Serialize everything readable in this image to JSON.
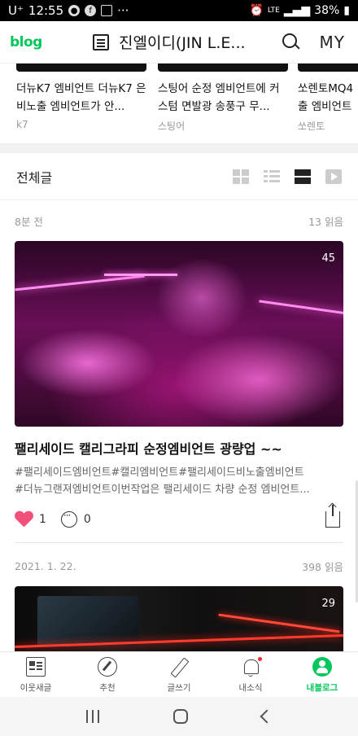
{
  "status_bar": {
    "carrier": "U⁺",
    "time": "12:55",
    "notif_icons": [
      "talk-icon",
      "facebook-icon",
      "gallery-icon"
    ],
    "more": "···",
    "network": "LTE",
    "battery": "38%"
  },
  "header": {
    "logo": "blog",
    "blog_title": "진엘이디(JIN L.E...",
    "my_label": "MY"
  },
  "carousel": [
    {
      "title": "더뉴K7 엠비언트 더뉴K7 은 비노출 엠비언트가 안...",
      "tag": "k7"
    },
    {
      "title": "스팅어 순정 엠비언트에 커스텀 면발광 송풍구 무...",
      "tag": "스팅어"
    },
    {
      "title": "쏘렌토MQ4 출 엠비언트",
      "tag": "쏘렌토"
    }
  ],
  "section": {
    "title": "전체글"
  },
  "posts": [
    {
      "time": "8분 전",
      "reads": "13 읽음",
      "photo_count": "45",
      "title": "팰리세이드 캘리그라피 순정엠비언트 광량업 ~~",
      "desc1": "#팰리세이드엠비언트#캘리엠비언트#팰리세이드비노출엠비언트",
      "desc2": "#더뉴그랜져엠비언트이번작업은 팰리세이드 차량 순정 엠비언트...",
      "likes": "1",
      "comments": "0"
    },
    {
      "time": "2021. 1. 22.",
      "reads": "398 읽음",
      "photo_count": "29"
    }
  ],
  "bottom_nav": [
    {
      "label": "이웃새글",
      "icon": "feed-icon"
    },
    {
      "label": "추천",
      "icon": "compass-icon"
    },
    {
      "label": "글쓰기",
      "icon": "pen-icon"
    },
    {
      "label": "내소식",
      "icon": "bell-icon"
    },
    {
      "label": "내블로그",
      "icon": "profile-icon"
    }
  ],
  "colors": {
    "brand": "#03c75a",
    "like": "#f0507a"
  }
}
